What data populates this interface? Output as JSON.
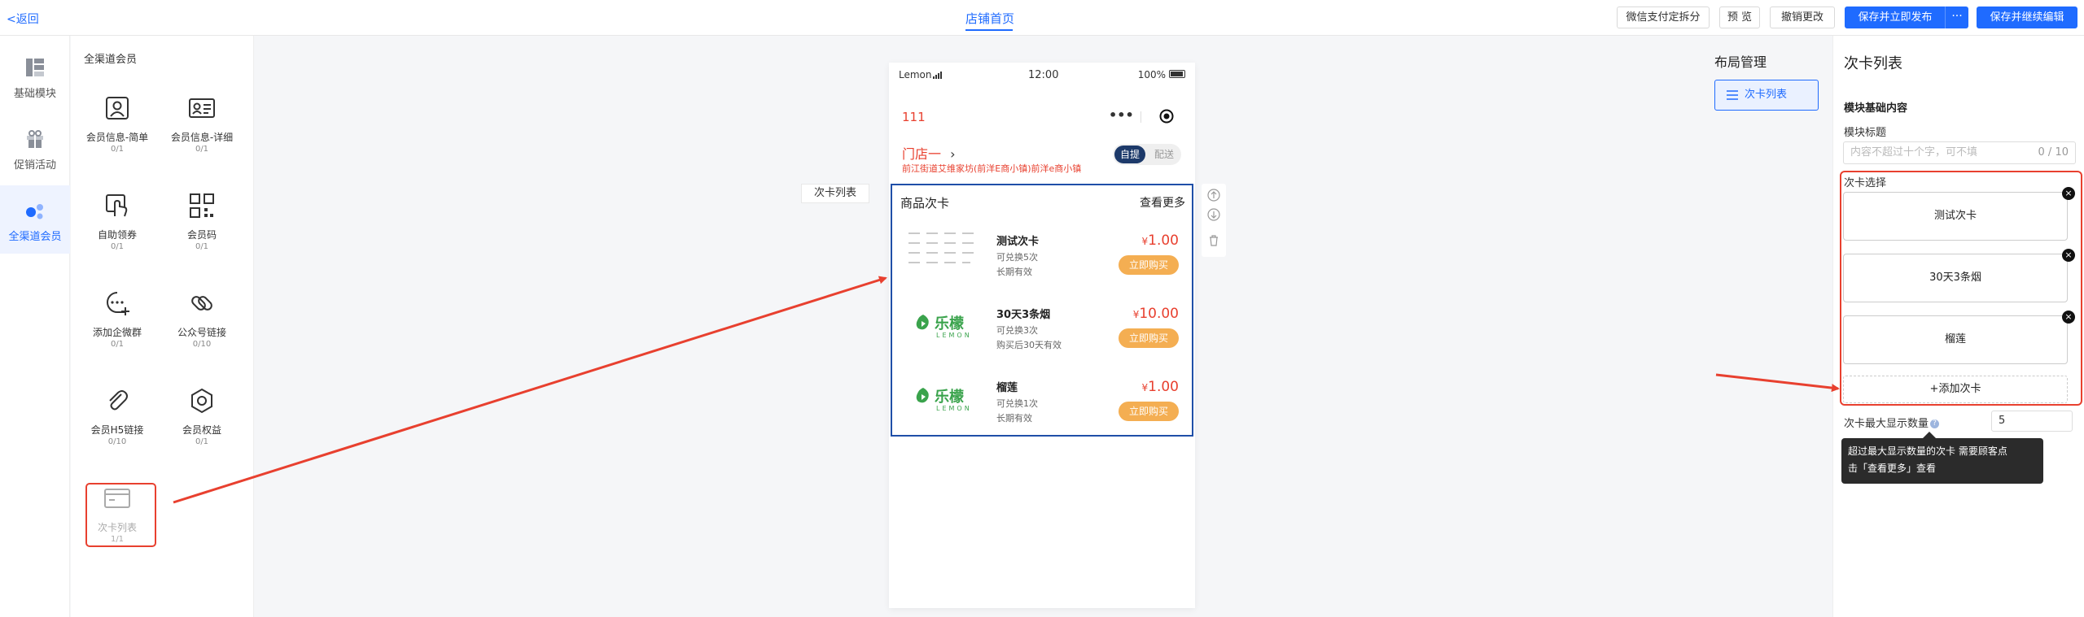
{
  "topbar": {
    "back": "<返回",
    "center_tab": "店铺首页",
    "buttons": {
      "wechat_split": "微信支付定拆分",
      "preview": "预 览",
      "undo": "撤销更改",
      "save_publish": "保存并立即发布",
      "more": "···",
      "save_continue": "保存并继续编辑"
    }
  },
  "left_nav": [
    {
      "label": "基础模块",
      "icon": "layout-blocks-icon"
    },
    {
      "label": "促销活动",
      "icon": "gift-icon"
    },
    {
      "label": "全渠道会员",
      "icon": "members-dots-icon",
      "active": true
    }
  ],
  "module_panel": {
    "title": "全渠道会员",
    "modules": [
      {
        "name": "会员信息-简单",
        "count": "0/1"
      },
      {
        "name": "会员信息-详细",
        "count": "0/1"
      },
      {
        "name": "自助领券",
        "count": "0/1"
      },
      {
        "name": "会员码",
        "count": "0/1"
      },
      {
        "name": "添加企微群",
        "count": "0/1"
      },
      {
        "name": "公众号链接",
        "count": "0/10"
      },
      {
        "name": "会员H5链接",
        "count": "0/10"
      },
      {
        "name": "会员权益",
        "count": "0/1"
      },
      {
        "name": "次卡列表",
        "count": "1/1"
      }
    ]
  },
  "canvas": {
    "module_label": "次卡列表",
    "phone": {
      "carrier": "Lemon",
      "time": "12:00",
      "battery": "100%",
      "shop_name": "111",
      "store_name": "门店一",
      "store_address": "前江街道艾维家坊(前洋E商小镇)前洋e商小镇",
      "toggle_on": "自提",
      "toggle_off": "配送",
      "section_title": "商品次卡",
      "section_more": "查看更多",
      "cards": [
        {
          "name": "测试次卡",
          "line1": "可兑换5次",
          "line2": "长期有效",
          "currency": "¥",
          "price": "1.00",
          "buy": "立即购买",
          "thumb": "text-pattern"
        },
        {
          "name": "30天3条烟",
          "line1": "可兑换3次",
          "line2": "购买后30天有效",
          "currency": "¥",
          "price": "10.00",
          "buy": "立即购买",
          "thumb": "lemon-logo"
        },
        {
          "name": "榴莲",
          "line1": "可兑换1次",
          "line2": "长期有效",
          "currency": "¥",
          "price": "1.00",
          "buy": "立即购买",
          "thumb": "lemon-logo"
        }
      ],
      "logo_cn": "乐檬",
      "logo_en": "LEMON"
    }
  },
  "layout_manage": {
    "title": "布局管理",
    "item": "次卡列表"
  },
  "right_panel": {
    "title": "次卡列表",
    "section": "模块基础内容",
    "module_title_label": "模块标题",
    "module_title_placeholder": "内容不超过十个字，可不填",
    "module_title_count": "0 / 10",
    "card_select_label": "次卡选择",
    "selected_cards": [
      "测试次卡",
      "30天3条烟",
      "榴莲"
    ],
    "delete_symbol": "×",
    "add_card": "+添加次卡",
    "max_label": "次卡最大显示数量",
    "max_value": "5",
    "tooltip_line1": "超过最大显示数量的次卡 需要顾客点",
    "tooltip_line2": "击「查看更多」查看"
  },
  "colors": {
    "accent": "#1f6bff",
    "annotation_red": "#e8402f",
    "price_red": "#e8402f",
    "buy_orange": "#f4ae52",
    "section_border": "#1f4fa8"
  }
}
